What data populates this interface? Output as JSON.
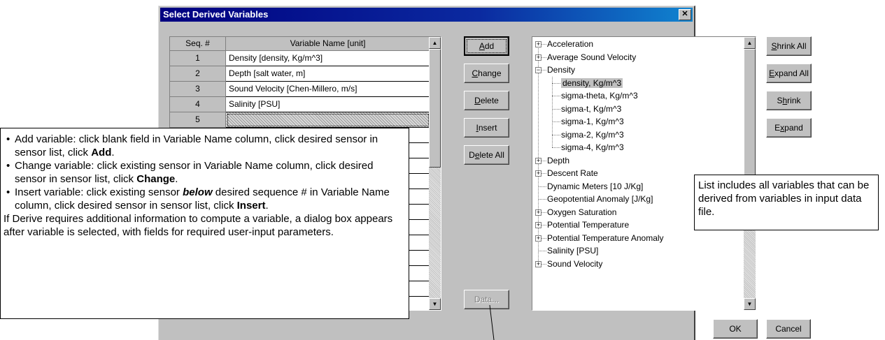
{
  "dialog": {
    "title": "Select Derived Variables",
    "close_glyph": "✕"
  },
  "grid": {
    "headers": {
      "seq": "Seq. #",
      "name": "Variable Name [unit]"
    },
    "rows": [
      {
        "seq": "1",
        "name": "Density [density, Kg/m^3]"
      },
      {
        "seq": "2",
        "name": "Depth [salt water, m]"
      },
      {
        "seq": "3",
        "name": "Sound Velocity [Chen-Millero, m/s]"
      },
      {
        "seq": "4",
        "name": "Salinity [PSU]"
      },
      {
        "seq": "5",
        "name": ""
      },
      {
        "seq": "",
        "name": ""
      },
      {
        "seq": "",
        "name": ""
      },
      {
        "seq": "",
        "name": ""
      },
      {
        "seq": "",
        "name": ""
      },
      {
        "seq": "",
        "name": ""
      },
      {
        "seq": "",
        "name": ""
      },
      {
        "seq": "",
        "name": ""
      },
      {
        "seq": "",
        "name": ""
      },
      {
        "seq": "",
        "name": ""
      },
      {
        "seq": "",
        "name": ""
      },
      {
        "seq": "",
        "name": ""
      },
      {
        "seq": "",
        "name": ""
      },
      {
        "seq": "",
        "name": ""
      }
    ]
  },
  "middle_buttons": {
    "add": {
      "pre": "",
      "key": "A",
      "post": "dd"
    },
    "change": {
      "pre": "",
      "key": "C",
      "post": "hange"
    },
    "delete": {
      "pre": "",
      "key": "D",
      "post": "elete"
    },
    "insert": {
      "pre": "",
      "key": "I",
      "post": "nsert"
    },
    "delete_all": {
      "pre": "D",
      "key": "e",
      "post": "lete All"
    },
    "data": "Data..."
  },
  "tree": {
    "acceleration": "Acceleration",
    "avg_sound_velocity": "Average Sound Velocity",
    "density": "Density",
    "density_children": [
      "density, Kg/m^3",
      "sigma-theta, Kg/m^3",
      "sigma-t, Kg/m^3",
      "sigma-1, Kg/m^3",
      "sigma-2, Kg/m^3",
      "sigma-4, Kg/m^3"
    ],
    "depth": "Depth",
    "descent_rate": "Descent Rate",
    "dynamic_meters": "Dynamic Meters [10 J/Kg]",
    "geopotential_anomaly": "Geopotential Anomaly [J/Kg]",
    "oxygen_saturation": "Oxygen Saturation",
    "potential_temperature": "Potential Temperature",
    "potential_temperature_anomaly": "Potential Temperature Anomaly",
    "salinity": "Salinity [PSU]",
    "sound_velocity": "Sound Velocity",
    "plus_glyph": "+",
    "minus_glyph": "−"
  },
  "right_buttons": {
    "shrink_all": {
      "pre": "",
      "key": "S",
      "post": "hrink All"
    },
    "expand_all": {
      "pre": "",
      "key": "E",
      "post": "xpand All"
    },
    "shrink": {
      "pre": "S",
      "key": "h",
      "post": "rink"
    },
    "expand": {
      "pre": "E",
      "key": "x",
      "post": "pand"
    }
  },
  "footer": {
    "ok": "OK",
    "cancel": "Cancel"
  },
  "scroll_glyphs": {
    "up": "▲",
    "down": "▼"
  },
  "callouts": {
    "left": {
      "bullets": [
        {
          "text": "Add variable: click blank field in Variable Name column, click desired sensor in sensor list, click ",
          "bold": "Add",
          "tail": "."
        },
        {
          "text": "Change variable: click existing sensor in Variable Name column, click desired sensor in sensor list, click ",
          "bold": "Change",
          "tail": "."
        },
        {
          "text_a": "Insert variable: click existing sensor ",
          "bold_italic": "below",
          "text_b": " desired sequence # in Variable Name column, click desired sensor in sensor list, click ",
          "bold": "Insert",
          "tail": "."
        }
      ],
      "paragraph": "If Derive requires additional information to compute a variable, a dialog box appears after variable is selected, with fields for required user-input parameters."
    },
    "right": "List includes all variables that can be derived from variables in input data file."
  }
}
